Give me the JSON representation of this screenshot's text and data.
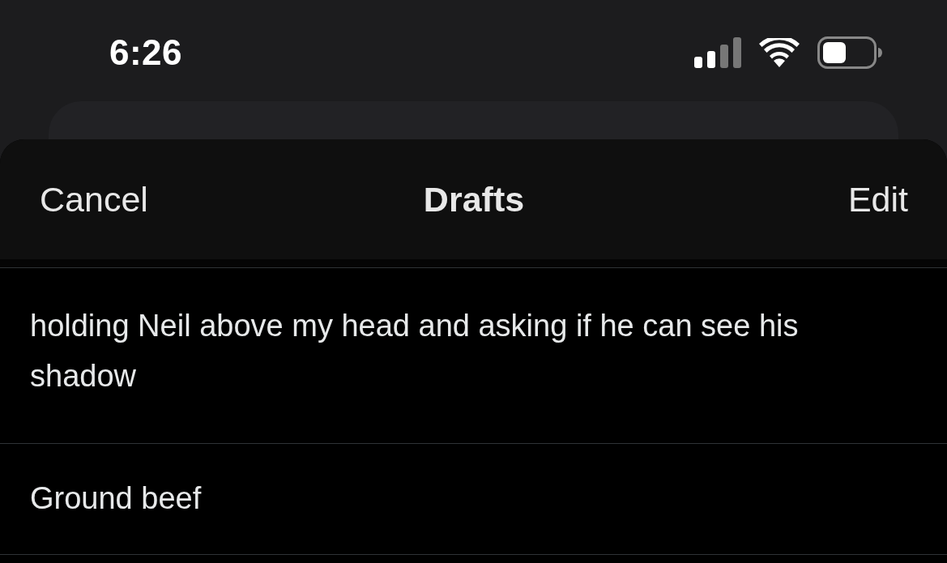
{
  "status_bar": {
    "time": "6:26"
  },
  "sheet": {
    "cancel": "Cancel",
    "title": "Drafts",
    "edit": "Edit"
  },
  "drafts": [
    {
      "text": "holding Neil above my head and asking if he can see his shadow"
    },
    {
      "text": "Ground beef"
    }
  ]
}
